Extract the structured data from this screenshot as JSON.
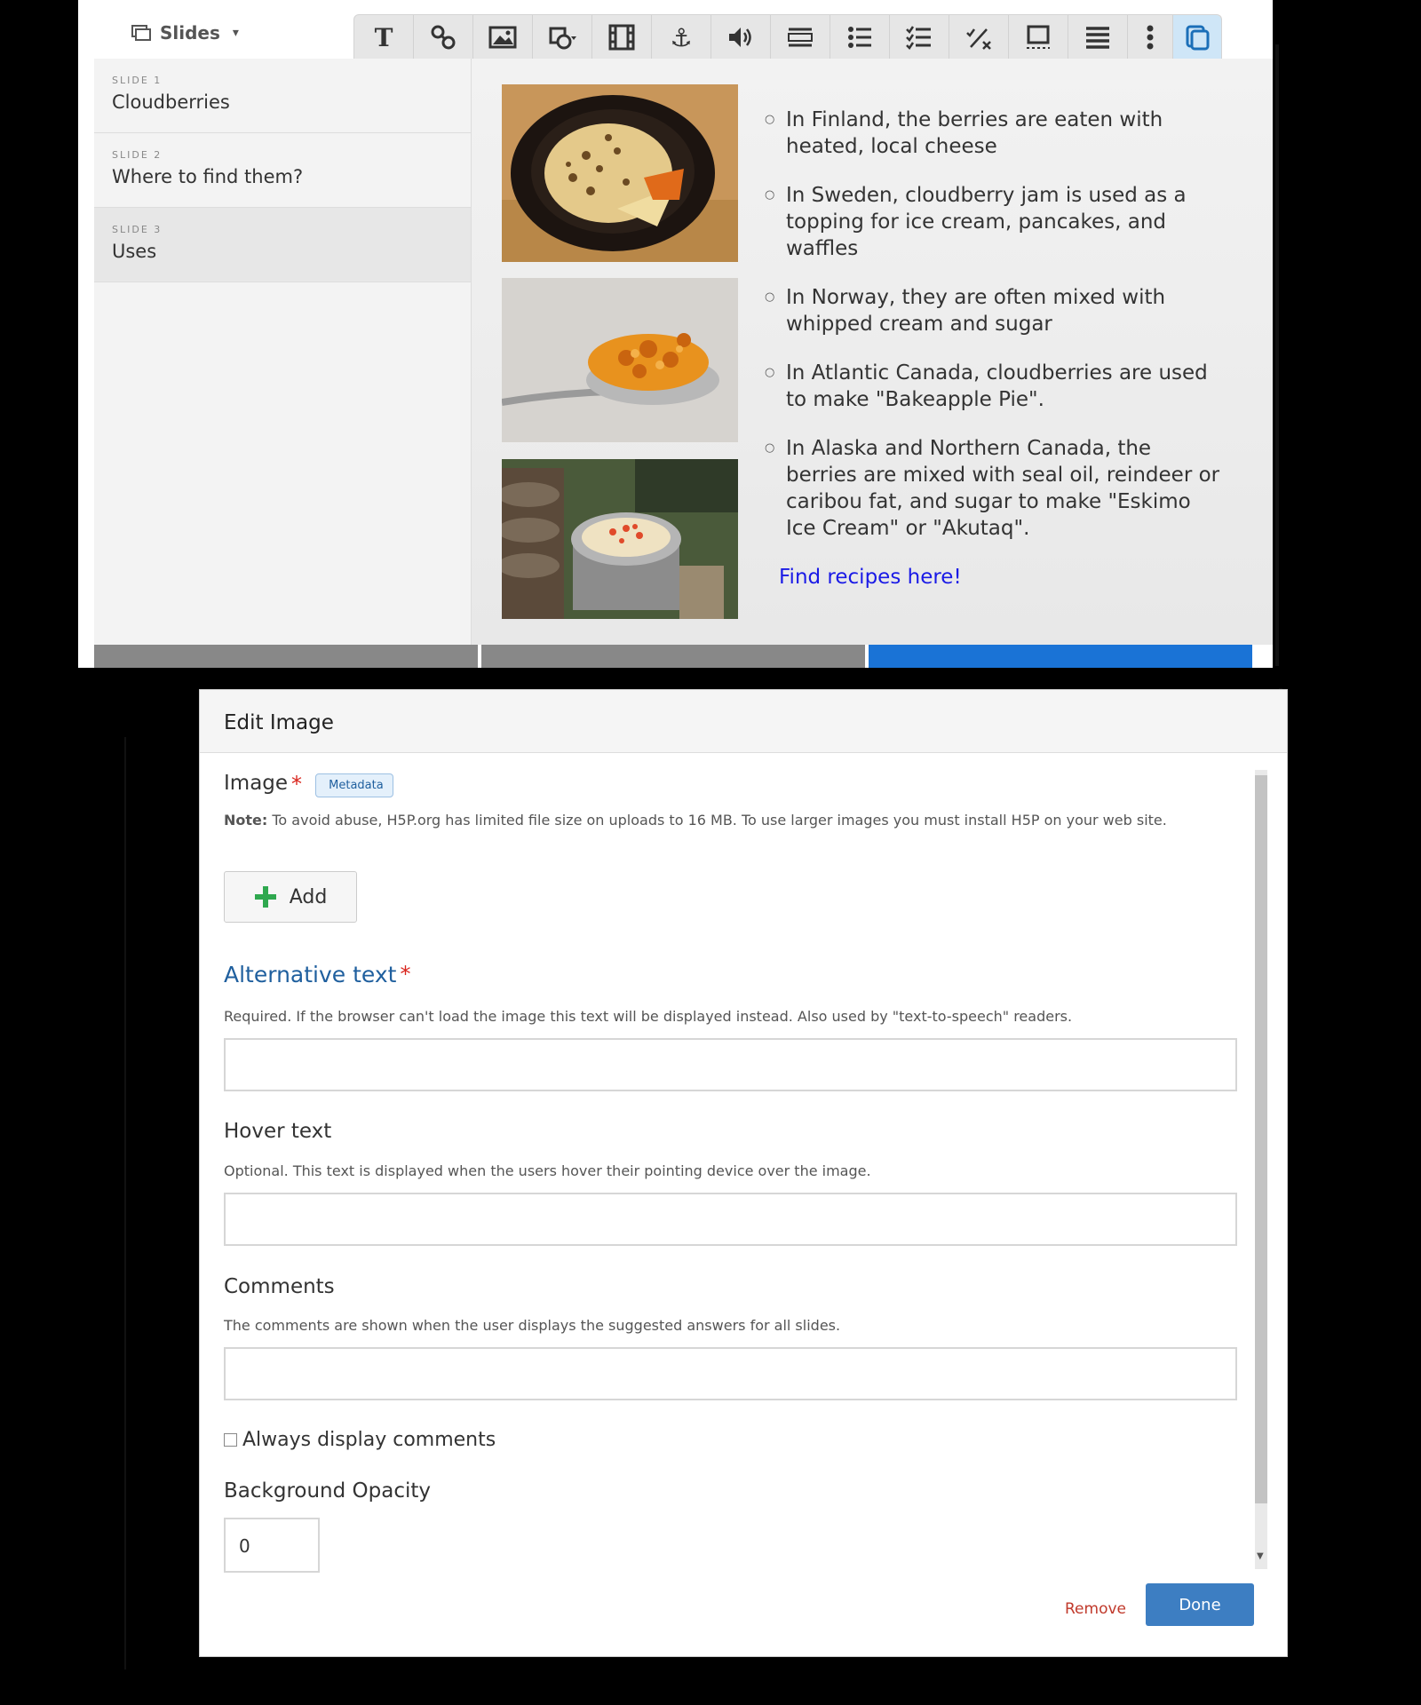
{
  "editor": {
    "slides_menu_label": "Slides",
    "toolbar": {
      "icons": [
        "text-icon",
        "link-icon",
        "image-icon",
        "shapes-icon",
        "video-icon",
        "anchor-icon",
        "audio-icon",
        "fill-in-blanks-icon",
        "single-choice-icon",
        "multi-choice-icon",
        "true-false-icon",
        "drag-text-icon",
        "summary-icon",
        "more-icon",
        "paste-icon"
      ],
      "active_color": "#cfe6f7"
    },
    "slides": [
      {
        "num": "SLIDE 1",
        "title": "Cloudberries"
      },
      {
        "num": "SLIDE 2",
        "title": "Where to find them?"
      },
      {
        "num": "SLIDE 3",
        "title": "Uses"
      }
    ],
    "bullets": [
      "In Finland, the berries are eaten with heated, local cheese",
      "In Sweden, cloudberry jam is used as a topping for ice cream, pancakes, and waffles",
      "In Norway, they are often mixed with whipped cream and sugar",
      "In Atlantic Canada, cloudberries are used to make \"Bakeapple Pie\".",
      "In Alaska and Northern Canada, the berries are mixed with seal oil, reindeer or caribou fat, and sugar to make \"Eskimo Ice Cream\" or \"Akutaq\"."
    ],
    "recipe_link": "Find recipes here!",
    "bottom_bar_colors": [
      "#888888",
      "#888888",
      "#1a73d6"
    ]
  },
  "dialog": {
    "title": "Edit Image",
    "image_label": "Image",
    "metadata_label": "Metadata",
    "note_bold": "Note:",
    "note_text": " To avoid abuse, H5P.org has limited file size on uploads to 16 MB. To use larger images you must install H5P on your web site.",
    "add_label": "Add",
    "alt_label": "Alternative text",
    "alt_desc": "Required. If the browser can't load the image this text will be displayed instead. Also used by \"text-to-speech\" readers.",
    "alt_value": "",
    "hover_label": "Hover text",
    "hover_desc": "Optional. This text is displayed when the users hover their pointing device over the image.",
    "hover_value": "",
    "comments_label": "Comments",
    "comments_desc": "The comments are shown when the user displays the suggested answers for all slides.",
    "comments_value": "",
    "always_display_label": "Always display comments",
    "always_display_checked": false,
    "opacity_label": "Background Opacity",
    "opacity_value": "0",
    "remove_label": "Remove",
    "done_label": "Done",
    "required_mark": "*",
    "alt_label_color": "#1f5f9e",
    "done_color": "#3d7ec2",
    "remove_color": "#c0392b"
  }
}
